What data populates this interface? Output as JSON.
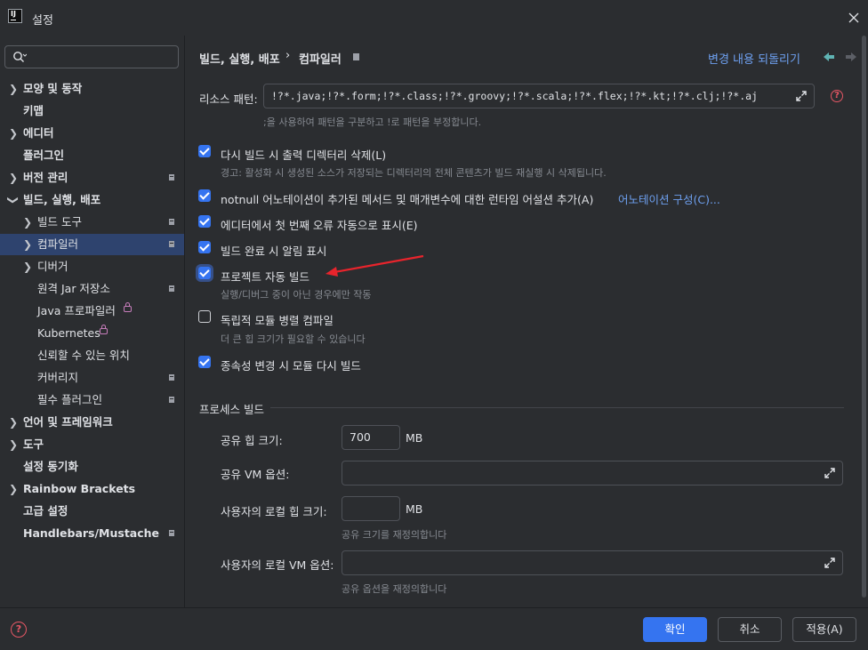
{
  "window": {
    "title": "설정"
  },
  "sidebar": {
    "search_placeholder": "",
    "items": [
      {
        "label": "모양 및 동작"
      },
      {
        "label": "키맵"
      },
      {
        "label": "에디터"
      },
      {
        "label": "플러그인"
      },
      {
        "label": "버전 관리"
      },
      {
        "label": "빌드, 실행, 배포"
      },
      {
        "label": "빌드 도구"
      },
      {
        "label": "컴파일러"
      },
      {
        "label": "디버거"
      },
      {
        "label": "원격 Jar 저장소"
      },
      {
        "label": "Java 프로파일러"
      },
      {
        "label": "Kubernetes"
      },
      {
        "label": "신뢰할 수 있는 위치"
      },
      {
        "label": "커버리지"
      },
      {
        "label": "필수 플러그인"
      },
      {
        "label": "언어 및 프레임워크"
      },
      {
        "label": "도구"
      },
      {
        "label": "설정 동기화"
      },
      {
        "label": "Rainbow Brackets"
      },
      {
        "label": "고급 설정"
      },
      {
        "label": "Handlebars/Mustache"
      }
    ]
  },
  "header": {
    "breadcrumb_parent": "빌드, 실행, 배포",
    "breadcrumb_current": "컴파일러",
    "revert_link": "변경 내용 되돌리기"
  },
  "resource_patterns": {
    "label": "리소스 패턴:",
    "value": "!?*.java;!?*.form;!?*.class;!?*.groovy;!?*.scala;!?*.flex;!?*.kt;!?*.clj;!?*.aj",
    "hint": ";을 사용하여 패턴을 구분하고 !로 패턴을 부정합니다."
  },
  "options": {
    "clear_output": {
      "label": "다시 빌드 시 출력 디렉터리 삭제(L)",
      "hint": "경고: 활성화 시 생성된 소스가 저장되는 디렉터리의 전체 콘텐츠가 빌드 재실행 시 삭제됩니다.",
      "checked": true
    },
    "notnull": {
      "label": "notnull 어노테이션이 추가된 메서드 및 매개변수에 대한 런타임 어설션 추가(A)",
      "link": "어노테이션 구성(C)...",
      "checked": true
    },
    "first_error": {
      "label": "에디터에서 첫 번째 오류 자동으로 표시(E)",
      "checked": true
    },
    "notify": {
      "label": "빌드 완료 시 알림 표시",
      "checked": true
    },
    "auto_build": {
      "label": "프로젝트 자동 빌드",
      "hint": "실행/디버그 중이 아닌 경우에만 작동",
      "checked": true
    },
    "parallel": {
      "label": "독립적 모듈 병렬 컴파일",
      "hint": "더 큰 힙 크기가 필요할 수 있습니다",
      "checked": false
    },
    "rebuild_deps": {
      "label": "종속성 변경 시 모듈 다시 빌드",
      "checked": true
    }
  },
  "build_process": {
    "section_title": "프로세스 빌드",
    "shared_heap_label": "공유 힙 크기:",
    "shared_heap_value": "700",
    "shared_heap_unit": "MB",
    "shared_vm_label": "공유 VM 옵션:",
    "shared_vm_value": "",
    "user_heap_label": "사용자의 로컬 힙 크기:",
    "user_heap_value": "",
    "user_heap_unit": "MB",
    "user_heap_hint": "공유 크기를 재정의합니다",
    "user_vm_label": "사용자의 로컬 VM 옵션:",
    "user_vm_value": "",
    "user_vm_hint": "공유 옵션을 재정의합니다"
  },
  "footer": {
    "ok": "확인",
    "cancel": "취소",
    "apply": "적용(A)"
  },
  "colors": {
    "accent": "#3574f0",
    "link": "#6ea0f0",
    "annotation_arrow": "#e8242c"
  }
}
